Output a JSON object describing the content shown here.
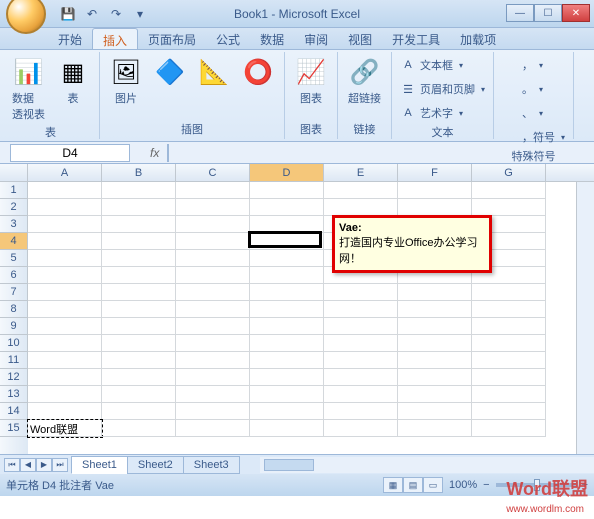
{
  "window": {
    "title": "Book1 - Microsoft Excel"
  },
  "tabs": {
    "items": [
      "开始",
      "插入",
      "页面布局",
      "公式",
      "数据",
      "审阅",
      "视图",
      "开发工具",
      "加载项"
    ],
    "active_index": 1
  },
  "ribbon": {
    "groups": [
      {
        "label": "表",
        "buttons": [
          {
            "label": "数据\n透视表",
            "icon": "📊"
          },
          {
            "label": "表",
            "icon": "▦"
          }
        ]
      },
      {
        "label": "插图",
        "buttons": [
          {
            "label": "图片",
            "icon": "🖼"
          },
          {
            "label": "",
            "icon": "🔷"
          },
          {
            "label": "",
            "icon": "📐"
          },
          {
            "label": "",
            "icon": "⭕"
          }
        ]
      },
      {
        "label": "图表",
        "buttons": [
          {
            "label": "图表",
            "icon": "📈"
          }
        ]
      },
      {
        "label": "链接",
        "buttons": [
          {
            "label": "超链接",
            "icon": "🔗"
          }
        ]
      },
      {
        "label": "文本",
        "small": [
          {
            "label": "文本框",
            "icon": "A"
          },
          {
            "label": "页眉和页脚",
            "icon": "☰"
          },
          {
            "label": "艺术字",
            "icon": "A"
          }
        ]
      },
      {
        "label": "特殊符号",
        "small": [
          {
            "label": "，",
            "icon": ""
          },
          {
            "label": "。",
            "icon": ""
          },
          {
            "label": "、",
            "icon": ""
          },
          {
            "label": "，符号",
            "icon": ""
          }
        ]
      }
    ]
  },
  "namebox": {
    "value": "D4",
    "fx": "fx"
  },
  "grid": {
    "columns": [
      "A",
      "B",
      "C",
      "D",
      "E",
      "F",
      "G"
    ],
    "rows": [
      1,
      2,
      3,
      4,
      5,
      6,
      7,
      8,
      9,
      10,
      11,
      12,
      13,
      14,
      15
    ],
    "cell_A1": "Word联盟",
    "selected": {
      "col": 3,
      "row": 3
    },
    "comment": {
      "author": "Vae:",
      "text": "打造国内专业Office办公学习网！"
    }
  },
  "sheets": {
    "items": [
      "Sheet1",
      "Sheet2",
      "Sheet3"
    ],
    "active_index": 0
  },
  "status": {
    "text": "单元格 D4 批注者 Vae",
    "zoom": "100%"
  },
  "watermark": {
    "brand": "Word联盟",
    "url": "www.wordlm.com"
  }
}
